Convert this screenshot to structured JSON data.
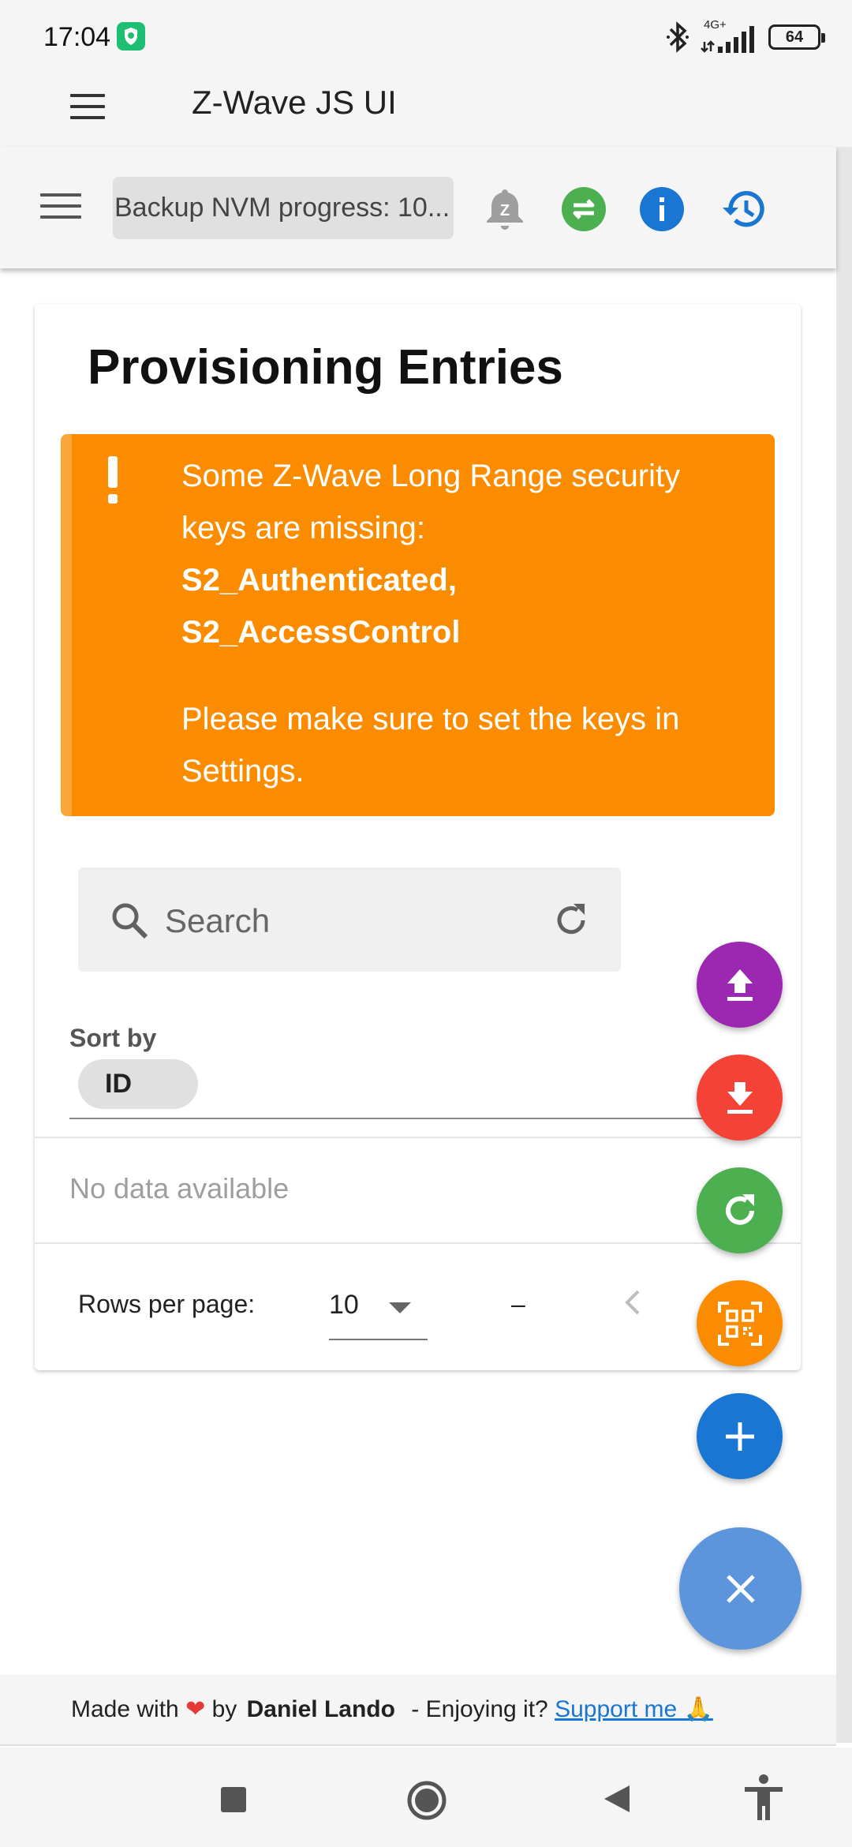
{
  "status_bar": {
    "time": "17:04",
    "network_label": "4G+",
    "battery": "64",
    "icons": [
      "shield-app-icon",
      "bluetooth-icon",
      "signal-icon",
      "battery-icon"
    ]
  },
  "app_bar": {
    "title": "Z-Wave JS UI",
    "menu_icon": "hamburger-menu-icon"
  },
  "toolbar": {
    "progress_text": "Backup NVM progress: 10...",
    "icons": [
      "zwave-bell-icon",
      "swap-arrows-icon",
      "info-icon",
      "history-icon"
    ],
    "colors": {
      "swap": "#4caf50",
      "info": "#1976d2",
      "history": "#1976d2"
    }
  },
  "card": {
    "title": "Provisioning Entries",
    "alert": {
      "line1": "Some Z-Wave Long Range security keys are missing:",
      "keys_line1": "S2_Authenticated,",
      "keys_line2": "S2_AccessControl",
      "line2": "Please make sure to set the keys in Settings.",
      "color": "#fb8c00"
    },
    "search": {
      "label": "Search"
    },
    "sort": {
      "label": "Sort by",
      "chip": "ID"
    },
    "no_data": "No data available",
    "pagination": {
      "rows_label": "Rows per page:",
      "rows_value": "10",
      "range": "–"
    }
  },
  "fabs": [
    {
      "name": "upload",
      "icon": "upload-icon",
      "color": "#9c27b0"
    },
    {
      "name": "download",
      "icon": "download-icon",
      "color": "#f44336"
    },
    {
      "name": "refresh",
      "icon": "refresh-icon",
      "color": "#4caf50"
    },
    {
      "name": "scan-qr",
      "icon": "qr-code-icon",
      "color": "#fb8c00"
    },
    {
      "name": "add",
      "icon": "plus-icon",
      "color": "#1976d2"
    },
    {
      "name": "close",
      "icon": "close-icon",
      "color": "#5c95dc"
    }
  ],
  "footer": {
    "made_with": "Made with",
    "by": "by",
    "author": "Daniel Lando",
    "enjoying": "- Enjoying it?",
    "support": "Support me 🙏"
  },
  "nav_bar": {
    "icons": [
      "recents-square-icon",
      "home-circle-icon",
      "back-triangle-icon",
      "accessibility-icon"
    ]
  }
}
